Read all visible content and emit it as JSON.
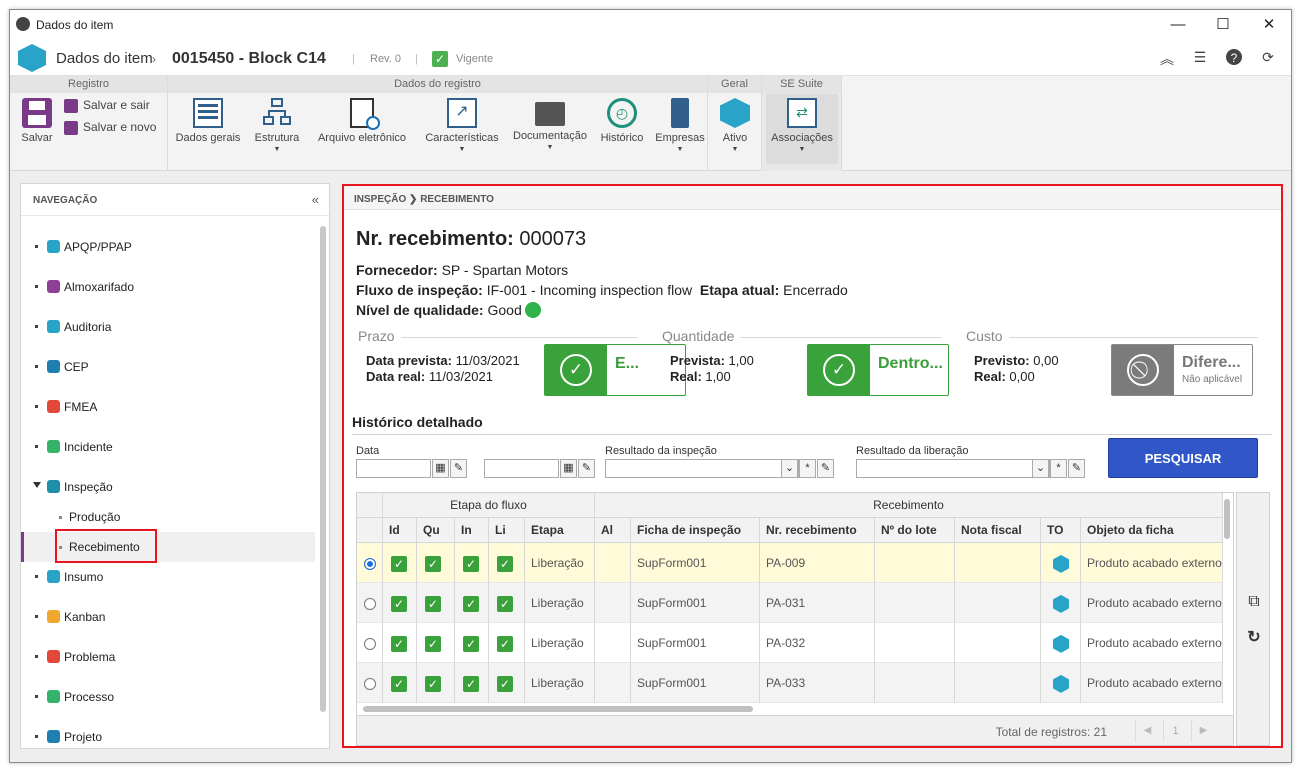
{
  "window": {
    "title": "Dados do item"
  },
  "header": {
    "title": "Dados do item",
    "item_code": "0015450 - Block C14",
    "revision": "Rev. 0",
    "status": "Vigente"
  },
  "ribbon": {
    "groups": [
      {
        "title": "Registro"
      },
      {
        "title": "Dados do registro"
      },
      {
        "title": "Geral"
      },
      {
        "title": "SE Suite"
      }
    ],
    "save": "Salvar",
    "save_exit": "Salvar e sair",
    "save_new": "Salvar e novo",
    "buttons": [
      {
        "label": "Dados gerais",
        "icon": "form-icon"
      },
      {
        "label": "Estrutura",
        "icon": "structure-icon"
      },
      {
        "label": "Arquivo eletrônico",
        "icon": "web-file-icon"
      },
      {
        "label": "Características",
        "icon": "chart-icon"
      },
      {
        "label": "Documentação",
        "icon": "folder-icon"
      },
      {
        "label": "Histórico",
        "icon": "history-icon"
      },
      {
        "label": "Empresas",
        "icon": "company-icon"
      },
      {
        "label": "Ativo",
        "icon": "asset-icon"
      },
      {
        "label": "Associações",
        "icon": "association-icon"
      }
    ]
  },
  "nav": {
    "title": "NAVEGAÇÃO",
    "items": [
      {
        "label": "APQP/PPAP",
        "color": "#2aa3c9"
      },
      {
        "label": "Almoxarifado",
        "color": "#8e3f96"
      },
      {
        "label": "Auditoria",
        "color": "#2aa3c9"
      },
      {
        "label": "CEP",
        "color": "#1f7fb3"
      },
      {
        "label": "FMEA",
        "color": "#e2483a"
      },
      {
        "label": "Incidente",
        "color": "#36b36b"
      },
      {
        "label": "Inspeção",
        "color": "#1d8fa8"
      },
      {
        "label": "Produção",
        "color": ""
      },
      {
        "label": "Recebimento",
        "color": ""
      },
      {
        "label": "Insumo",
        "color": "#2aa3c9"
      },
      {
        "label": "Kanban",
        "color": "#f0a830"
      },
      {
        "label": "Problema",
        "color": "#e2483a"
      },
      {
        "label": "Processo",
        "color": "#36b36b"
      },
      {
        "label": "Projeto",
        "color": "#1f7fb3"
      }
    ]
  },
  "main": {
    "breadcrumb": [
      "INSPEÇÃO",
      "RECEBIMENTO"
    ],
    "title_label": "Nr. recebimento:",
    "title_value": "000073",
    "supplier_label": "Fornecedor:",
    "supplier_value": "SP - Spartan Motors",
    "flow_label": "Fluxo de inspeção:",
    "flow_value": "IF-001 - Incoming inspection flow",
    "stage_label": "Etapa atual:",
    "stage_value": "Encerrado",
    "quality_label": "Nível de qualidade:",
    "quality_value": "Good",
    "prazo": {
      "label": "Prazo",
      "expected_label": "Data prevista:",
      "expected_value": "11/03/2021",
      "real_label": "Data real:",
      "real_value": "11/03/2021",
      "status": "E..."
    },
    "quantidade": {
      "label": "Quantidade",
      "expected_label": "Prevista:",
      "expected_value": "1,00",
      "real_label": "Real:",
      "real_value": "1,00",
      "status": "Dentro..."
    },
    "custo": {
      "label": "Custo",
      "expected_label": "Previsto:",
      "expected_value": "0,00",
      "real_label": "Real:",
      "real_value": "0,00",
      "status": "Difere...",
      "status_sub": "Não aplicável"
    },
    "history_title": "Histórico detalhado",
    "filters": {
      "date_label": "Data",
      "inspection_result_label": "Resultado da inspeção",
      "release_result_label": "Resultado da liberação",
      "search_button": "PESQUISAR"
    },
    "grid": {
      "group_headers": [
        "Etapa do fluxo",
        "Recebimento"
      ],
      "columns": [
        "Id",
        "Qu",
        "In",
        "Li",
        "Etapa",
        "Al",
        "Ficha de inspeção",
        "Nr. recebimento",
        "Nº do lote",
        "Nota fiscal",
        "TO",
        "Objeto da ficha"
      ],
      "rows": [
        {
          "selected": true,
          "etapa": "Liberação",
          "ficha": "SupForm001",
          "nr": "PA-009",
          "objeto": "Produto acabado externo"
        },
        {
          "selected": false,
          "etapa": "Liberação",
          "ficha": "SupForm001",
          "nr": "PA-031",
          "objeto": "Produto acabado externo"
        },
        {
          "selected": false,
          "etapa": "Liberação",
          "ficha": "SupForm001",
          "nr": "PA-032",
          "objeto": "Produto acabado externo"
        },
        {
          "selected": false,
          "etapa": "Liberação",
          "ficha": "SupForm001",
          "nr": "PA-033",
          "objeto": "Produto acabado externo"
        }
      ],
      "total_label": "Total de registros: 21",
      "page": "1"
    }
  }
}
